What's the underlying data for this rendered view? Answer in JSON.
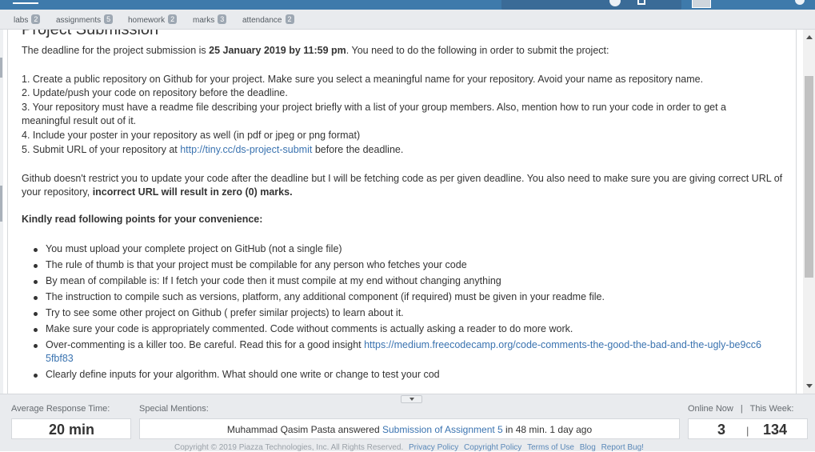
{
  "folders": [
    {
      "label": "labs",
      "count": "2"
    },
    {
      "label": "assignments",
      "count": "5"
    },
    {
      "label": "homework",
      "count": "2"
    },
    {
      "label": "marks",
      "count": "3"
    },
    {
      "label": "attendance",
      "count": "2"
    }
  ],
  "post": {
    "title": "Project Submission",
    "intro_pre": "The deadline for the project submission is ",
    "intro_deadline": "25 January 2019 by 11:59 pm",
    "intro_post": ". You need to do the following in order to submit the project:",
    "steps": [
      "1. Create a public repository on Github for your project. Make sure you select a meaningful name for your repository. Avoid your name as repository name.",
      "2. Update/push your code on repository before the deadline.",
      "3. Your repository must have a readme file describing your project briefly with a list of your group members. Also, mention how to run your code in order to get a meaningful result out of it.",
      "4. Include your poster in your repository as well (in pdf or jpeg or png format)"
    ],
    "step5_pre": "5. Submit URL of your repository at ",
    "step5_link": "http://tiny.cc/ds-project-submit",
    "step5_post": " before the deadline.",
    "github_note": "Github doesn't restrict you to update your code after the deadline but I will be fetching code as per given deadline. You also need to make sure you are giving correct URL of your repository, ",
    "github_note_bold": "incorrect URL will result in zero (0) marks.",
    "points_heading": "Kindly read following points for your convenience:",
    "points": [
      "You must upload your complete project on GitHub (not a single file)",
      "The rule of thumb is that your project must be compilable for any person who fetches your code",
      "By mean of compilable is: If I fetch your code then it must compile at my end without changing anything",
      "The instruction to compile such as versions, platform, any additional component (if required) must be given in your readme file.",
      "Try to see some other project on Github ( prefer similar projects) to learn about it.",
      "Make sure your code is appropriately commented. Code without comments is actually asking a reader to do more work."
    ],
    "point7_pre": "Over-commenting is a killer too. Be careful. Read this for a good insight ",
    "point7_link": "https://medium.freecodecamp.org/code-comments-the-good-the-bad-and-the-ugly-be9cc65fbf83",
    "point8": "Clearly define inputs for your algorithm. What should one write or change to test your cod"
  },
  "footer": {
    "avg_label": "Average Response Time:",
    "avg_value": "20 min",
    "mentions_label": "Special Mentions:",
    "mention_pre": "Muhammad Qasim Pasta answered ",
    "mention_link": "Submission of Assignment 5",
    "mention_post": " in 48 min. 1 day ago",
    "online_label": "Online Now",
    "sep": "|",
    "week_label": "This Week:",
    "online_value": "3",
    "week_value": "134",
    "copyright": "Copyright © 2019 Piazza Technologies, Inc. All Rights Reserved.",
    "links": [
      "Privacy Policy",
      "Copyright Policy",
      "Terms of Use",
      "Blog",
      "Report Bug!"
    ]
  },
  "colors": {
    "nav": "#3e7aab",
    "link": "#3a73b0",
    "badge": "#9da7b2",
    "footer_bg": "#e9ebee"
  }
}
